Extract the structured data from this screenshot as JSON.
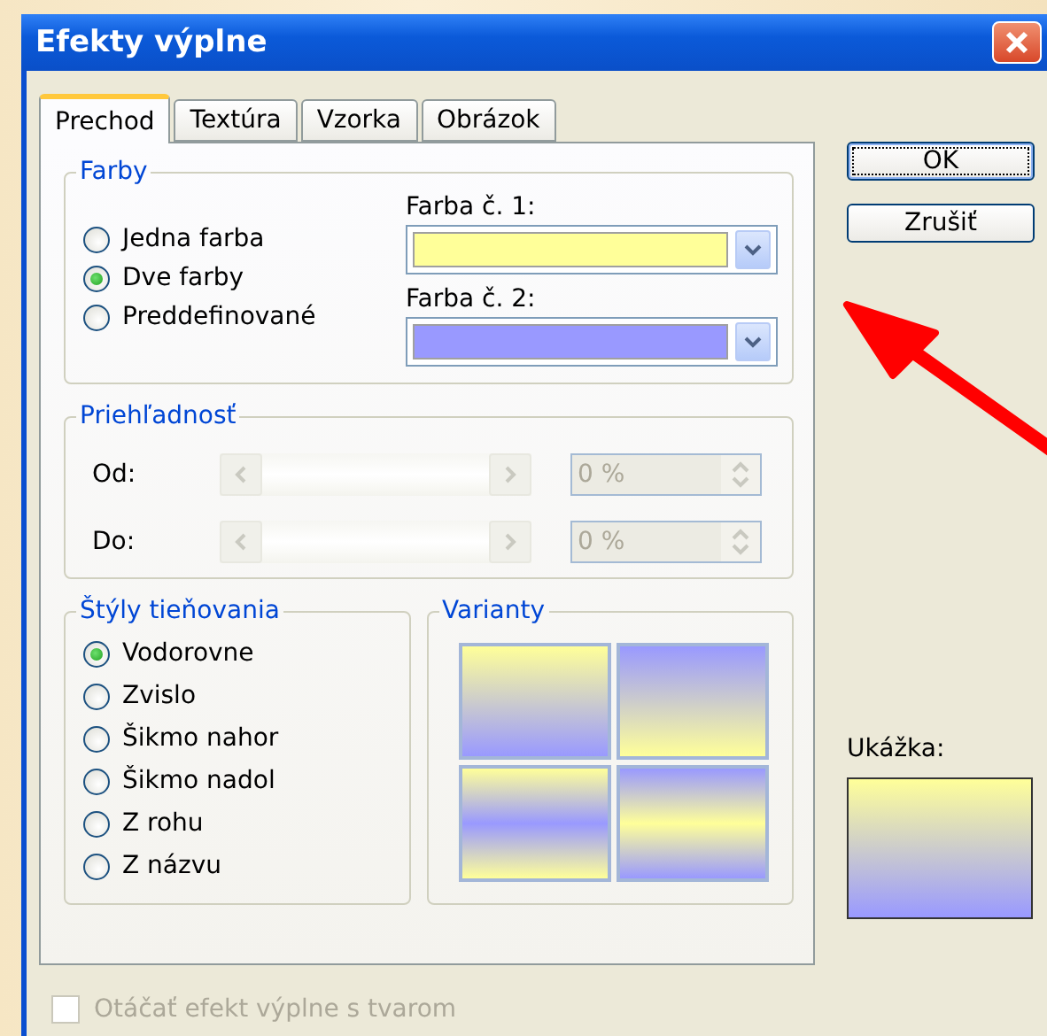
{
  "window": {
    "title": "Efekty výplne"
  },
  "tabs": [
    {
      "label": "Prechod",
      "selected": true
    },
    {
      "label": "Textúra",
      "selected": false
    },
    {
      "label": "Vzorka",
      "selected": false
    },
    {
      "label": "Obrázok",
      "selected": false
    }
  ],
  "colors": {
    "title": "Farby",
    "options": [
      {
        "label": "Jedna farba",
        "selected": false
      },
      {
        "label": "Dve farby",
        "selected": true
      },
      {
        "label": "Preddefinované",
        "selected": false
      }
    ],
    "pickers": [
      {
        "label": "Farba č. 1:",
        "color": "#ffff99"
      },
      {
        "label": "Farba č. 2:",
        "color": "#9999ff"
      }
    ]
  },
  "transparency": {
    "title": "Priehľadnosť",
    "rows": [
      {
        "label": "Od:",
        "value": "0 %",
        "disabled": true
      },
      {
        "label": "Do:",
        "value": "0 %",
        "disabled": true
      }
    ]
  },
  "shading_styles": {
    "title": "Štýly tieňovania",
    "options": [
      {
        "label": "Vodorovne",
        "selected": true
      },
      {
        "label": "Zvislo",
        "selected": false
      },
      {
        "label": "Šikmo nahor",
        "selected": false
      },
      {
        "label": "Šikmo nadol",
        "selected": false
      },
      {
        "label": "Z rohu",
        "selected": false
      },
      {
        "label": "Z názvu",
        "selected": false
      }
    ]
  },
  "variants": {
    "title": "Varianty"
  },
  "buttons": [
    {
      "label": "OK",
      "default": true
    },
    {
      "label": "Zrušiť",
      "default": false
    }
  ],
  "preview": {
    "label": "Ukážka:"
  },
  "rotate_checkbox": {
    "label": "Otáčať efekt výplne s tvarom",
    "checked": false,
    "disabled": true
  }
}
